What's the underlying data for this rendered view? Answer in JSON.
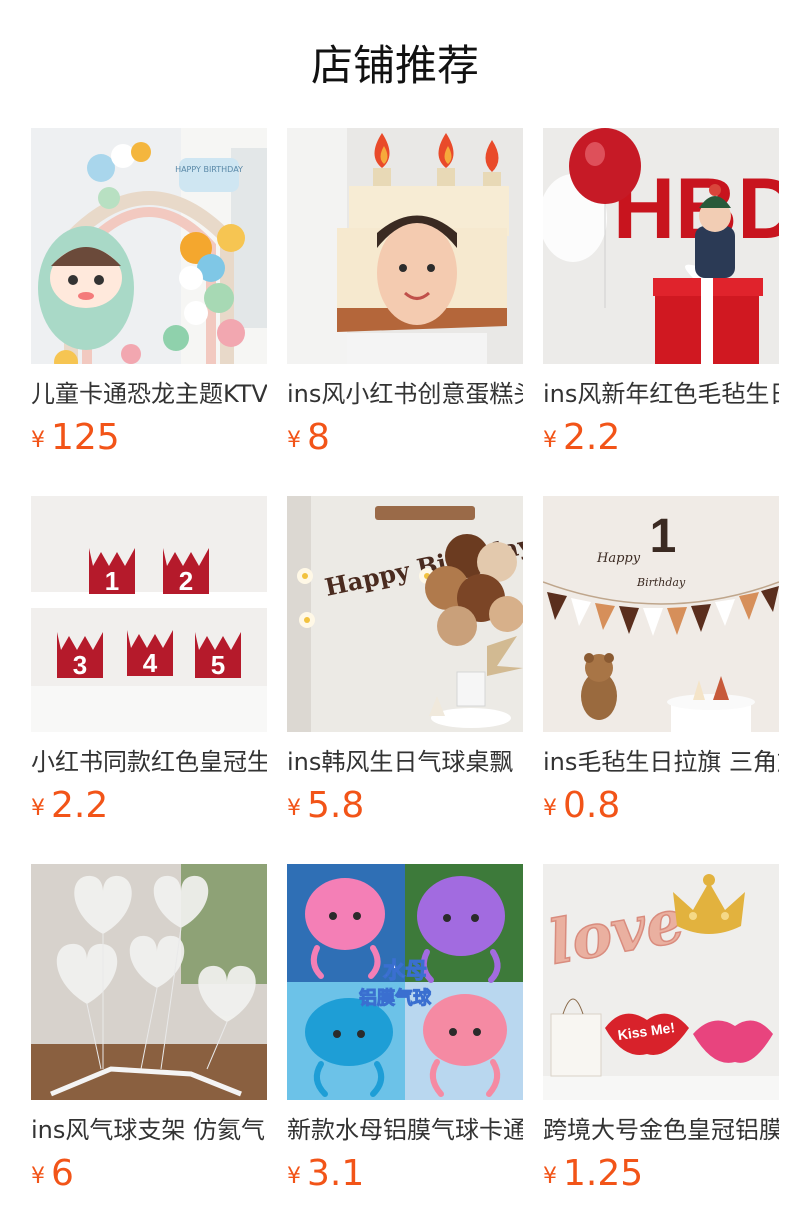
{
  "header": {
    "title": "店铺推荐"
  },
  "currency_symbol": "¥",
  "products": [
    {
      "name": "儿童卡通恐龙主题KTV",
      "price": "125",
      "image": "dinosaur-balloon-arch-image"
    },
    {
      "name": "ins风小红书创意蛋糕头套",
      "price": "8",
      "image": "cake-hat-child-image"
    },
    {
      "name": "ins风新年红色毛毡生日",
      "price": "2.2",
      "image": "red-balloon-gift-box-image"
    },
    {
      "name": "小红书同款红色皇冠生日帽",
      "price": "2.2",
      "image": "red-felt-crowns-image"
    },
    {
      "name": "ins韩风生日气球桌飘",
      "price": "5.8",
      "image": "happy-birthday-banner-image"
    },
    {
      "name": "ins毛毡生日拉旗 三角旗",
      "price": "0.8",
      "image": "pennant-flag-banner-image"
    },
    {
      "name": "ins风气球支架 仿氦气",
      "price": "6",
      "image": "white-heart-balloons-image"
    },
    {
      "name": "新款水母铝膜气球卡通",
      "price": "3.1",
      "image": "jellyfish-foil-balloons-image"
    },
    {
      "name": "跨境大号金色皇冠铝膜气球",
      "price": "1.25",
      "image": "love-crown-foil-balloons-image"
    }
  ],
  "image_texts": {
    "birthday_sign": "HAPPY BIRTHDAY",
    "banner_letters": "HBD",
    "crown_numbers": [
      "1",
      "2",
      "3",
      "4",
      "5"
    ],
    "happy_birthday": "Happy Birthday",
    "number_one": "1",
    "script_happy": "Happy",
    "script_birthday": "Birthday",
    "jellyfish_caption": "水母",
    "jellyfish_caption2": "铝膜气球",
    "love_word": "love",
    "kiss_me": "Kiss Me!"
  }
}
